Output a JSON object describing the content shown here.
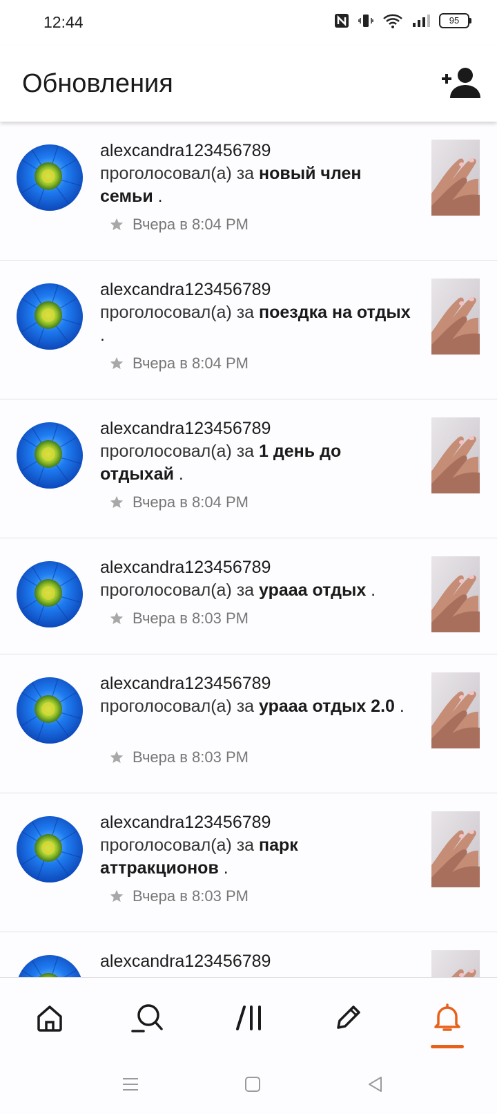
{
  "status_bar": {
    "time": "12:44",
    "battery": "95",
    "icons": [
      "nfc-icon",
      "vibrate-icon",
      "wifi-icon",
      "signal-icon",
      "battery-icon"
    ]
  },
  "header": {
    "title": "Обновления",
    "add_friend_icon": "add-user-icon"
  },
  "feed": {
    "items": [
      {
        "username": "alexcandra123456789",
        "action": "проголосовал(а) за ",
        "target": "новый член семьи",
        "suffix": " .",
        "time": "Вчера в 8:04 PM"
      },
      {
        "username": "alexcandra123456789",
        "action": "проголосовал(а) за ",
        "target": "поездка на отдых",
        "suffix": " .",
        "time": "Вчера в 8:04 PM"
      },
      {
        "username": "alexcandra123456789",
        "action": "проголосовал(а) за ",
        "target": "1 день до отдыхай",
        "suffix": " .",
        "time": "Вчера в 8:04 PM"
      },
      {
        "username": "alexcandra123456789",
        "action": "проголосовал(а) за ",
        "target": "урааа отдых",
        "suffix": " .",
        "time": "Вчера в 8:03 PM"
      },
      {
        "username": "alexcandra123456789",
        "action": "проголосовал(а) за ",
        "target": "урааа отдых 2.0",
        "suffix": " .",
        "time": "Вчера в 8:03 PM"
      },
      {
        "username": "alexcandra123456789",
        "action": "проголосовал(а) за ",
        "target": "парк аттракционов",
        "suffix": " .",
        "time": "Вчера в 8:03 PM"
      },
      {
        "username": "alexcandra123456789"
      }
    ]
  },
  "bottom_nav": {
    "items": [
      "home-icon",
      "search-icon",
      "collections-icon",
      "edit-icon",
      "notifications-icon"
    ],
    "active": "notifications-icon",
    "active_color": "#e8611a"
  },
  "system_nav": [
    "menu-icon",
    "home-square-icon",
    "back-icon"
  ]
}
